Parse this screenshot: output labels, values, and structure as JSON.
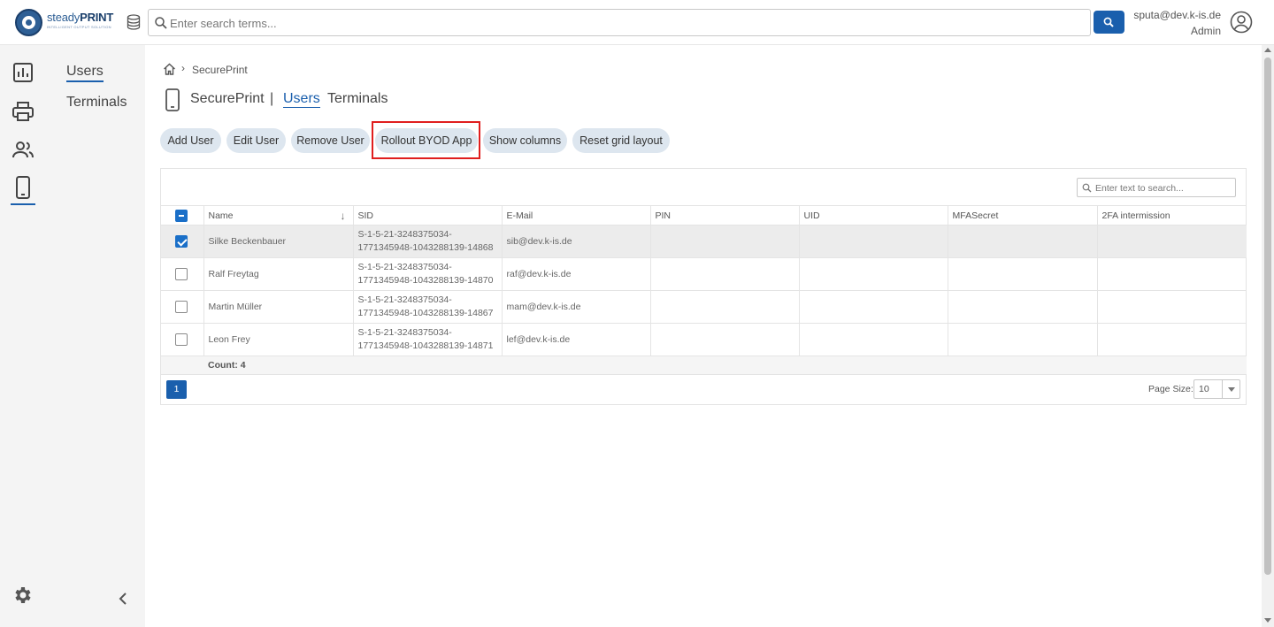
{
  "brand": {
    "name_light": "steady",
    "name_bold": "PRINT",
    "tagline": "INTELLIGENT OUTPUT SOLUTION"
  },
  "search": {
    "placeholder": "Enter search terms..."
  },
  "user": {
    "email": "sputa@dev.k-is.de",
    "role": "Admin"
  },
  "rail": {
    "items": [
      {
        "icon": "dashboard-icon"
      },
      {
        "icon": "printer-icon"
      },
      {
        "icon": "users-icon"
      },
      {
        "icon": "mobile-phone-icon",
        "active": true
      }
    ],
    "settings_icon": "gear-icon"
  },
  "subnav": {
    "items": [
      {
        "label": "Users",
        "active": true
      },
      {
        "label": "Terminals",
        "active": false
      }
    ]
  },
  "breadcrumb": {
    "separator": "›",
    "current": "SecurePrint"
  },
  "page": {
    "app": "SecurePrint",
    "divider": "|",
    "tabs": [
      {
        "label": "Users",
        "active": true
      },
      {
        "label": "Terminals",
        "active": false
      }
    ]
  },
  "toolbar": {
    "buttons": [
      "Add User",
      "Edit User",
      "Remove User",
      "Rollout BYOD App",
      "Show columns",
      "Reset grid layout"
    ]
  },
  "grid": {
    "search_placeholder": "Enter text to search...",
    "columns": [
      "Name",
      "SID",
      "E-Mail",
      "PIN",
      "UID",
      "MFASecret",
      "2FA intermission"
    ],
    "sort_indicator": "↓",
    "rows": [
      {
        "selected": true,
        "name": "Silke Beckenbauer",
        "sid_line1": "S-1-5-21-3248375034-",
        "sid_line2": "1771345948-1043288139-14868",
        "email": "sib@dev.k-is.de",
        "pin": "",
        "uid": "",
        "mfa": "",
        "intermission": ""
      },
      {
        "selected": false,
        "name": "Ralf Freytag",
        "sid_line1": "S-1-5-21-3248375034-",
        "sid_line2": "1771345948-1043288139-14870",
        "email": "raf@dev.k-is.de",
        "pin": "",
        "uid": "",
        "mfa": "",
        "intermission": ""
      },
      {
        "selected": false,
        "name": "Martin Müller",
        "sid_line1": "S-1-5-21-3248375034-",
        "sid_line2": "1771345948-1043288139-14867",
        "email": "mam@dev.k-is.de",
        "pin": "",
        "uid": "",
        "mfa": "",
        "intermission": ""
      },
      {
        "selected": false,
        "name": "Leon Frey",
        "sid_line1": "S-1-5-21-3248375034-",
        "sid_line2": "1771345948-1043288139-14871",
        "email": "lef@dev.k-is.de",
        "pin": "",
        "uid": "",
        "mfa": "",
        "intermission": ""
      }
    ],
    "count_label": "Count: 4",
    "page": "1",
    "page_size_label": "Page Size:",
    "page_size": "10"
  },
  "colors": {
    "accent": "#1a5fad",
    "highlight": "#e01e1e",
    "button_bg": "#dde6ef"
  }
}
